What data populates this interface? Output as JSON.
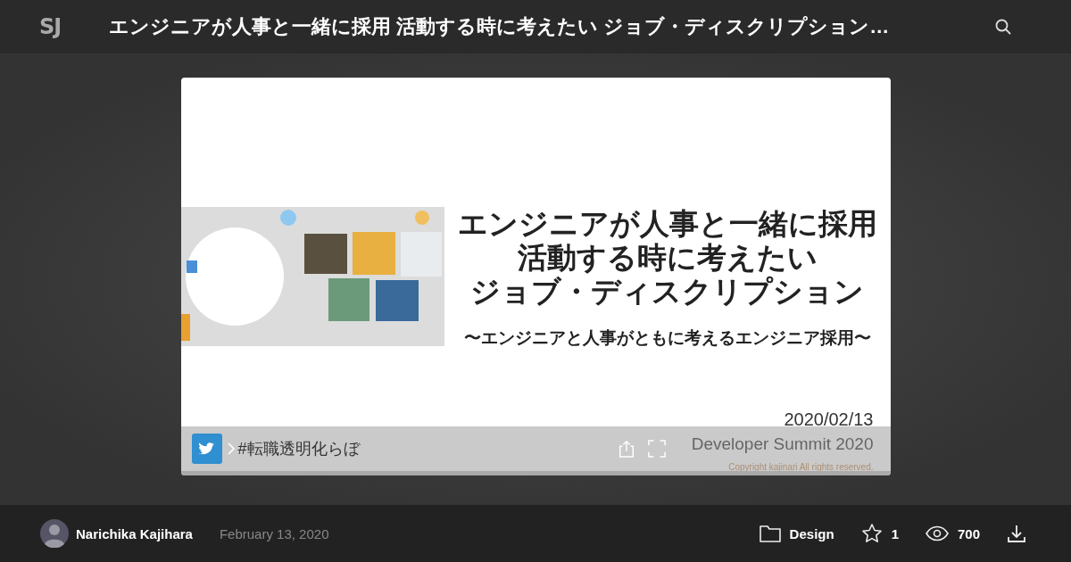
{
  "header": {
    "logo": "SJ",
    "title": "エンジニアが人事と一緒に採用 活動する時に考えたい ジョブ・ディスクリプション…"
  },
  "slide": {
    "title_lines": [
      "エンジニアが人事と一緒に採用",
      "活動する時に考えたい",
      "ジョブ・ディスクリプション"
    ],
    "subtitle": "〜エンジニアと人事がともに考えるエンジニア採用〜",
    "date": "2020/02/13",
    "event": "Developer Summit 2020",
    "copyright": "Copyright kajinari All rights reserved.",
    "hashtag": "#転職透明化らぼ"
  },
  "footer": {
    "author": "Narichika Kajihara",
    "date": "February 13, 2020",
    "category": "Design",
    "stars": "1",
    "views": "700"
  }
}
